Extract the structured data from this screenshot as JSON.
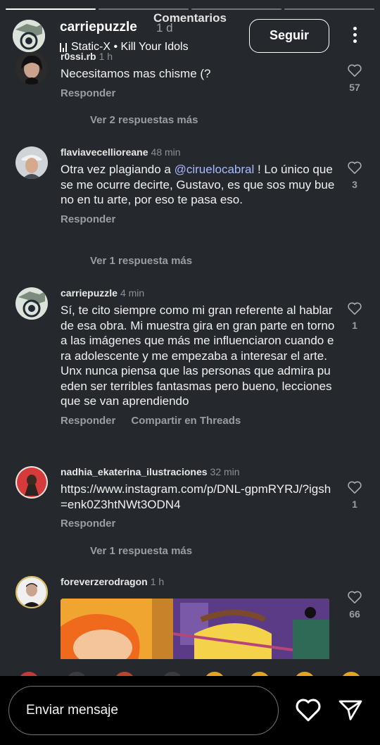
{
  "sheet_title": "Comentarios",
  "story": {
    "username": "carriepuzzle",
    "time": "1 d",
    "music": "Static-X • Kill Your Idols",
    "follow_label": "Seguir"
  },
  "comments": [
    {
      "username": "r0ssi.rb",
      "time": "1 h",
      "text": "Necesitamos mas chisme (?",
      "actions": [
        "Responder"
      ],
      "likes": "57",
      "more_replies": "Ver 2 respuestas más"
    },
    {
      "username": "flaviavecellioreane",
      "time": "48 min",
      "text_before": "Otra vez plagiando a ",
      "mention": "@ciruelocabral",
      "text_after": " ! Lo único que se me ocurre decirte, Gustavo, es que sos muy bueno en tu arte, por eso te pasa eso.",
      "actions": [
        "Responder"
      ],
      "likes": "3",
      "more_replies": "Ver 1 respuesta más"
    },
    {
      "username": "carriepuzzle",
      "time": "4 min",
      "text": "Sí, te cito siempre como mi gran referente al hablar de esa obra. Mi muestra gira en gran parte en torno a las imágenes que más me influenciaron cuando era adolescente y me empezaba a interesar el arte. Unx nunca piensa que las personas que admira pueden ser terribles fantasmas pero bueno, lecciones que se van aprendiendo",
      "actions": [
        "Responder",
        "Compartir en Threads"
      ],
      "likes": "1"
    },
    {
      "username": "nadhia_ekaterina_ilustraciones",
      "time": "32 min",
      "text": "https://www.instagram.com/p/DNL-gpmRYRJ/?igsh=enk0Z3htNWt3ODN4",
      "actions": [
        "Responder"
      ],
      "likes": "1",
      "more_replies": "Ver 1 respuesta más"
    },
    {
      "username": "foreverzerodragon",
      "time": "1 h",
      "likes": "66"
    }
  ],
  "composer": {
    "placeholder": "Enviar mensaje"
  },
  "icons": {
    "like": "heart-outline-icon",
    "send": "paper-plane-icon",
    "more": "more-vertical-icon"
  },
  "colors": {
    "background": "#25282d",
    "mention": "#a9b8ff",
    "muted": "#9a9da3"
  }
}
